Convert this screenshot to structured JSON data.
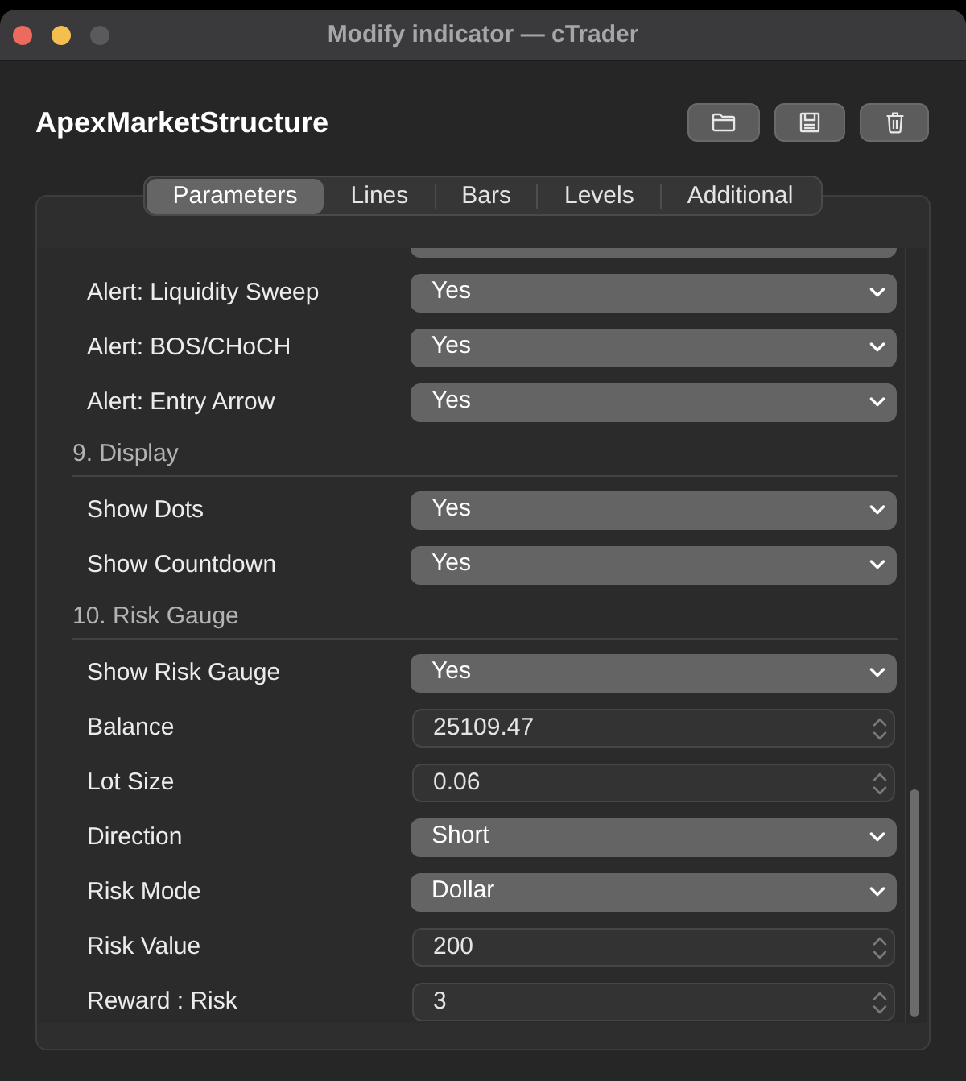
{
  "window": {
    "title": "Modify indicator — cTrader",
    "controls": [
      {
        "kind": "close",
        "disabled": false
      },
      {
        "kind": "minimize",
        "disabled": false
      },
      {
        "kind": "zoom",
        "disabled": true
      }
    ]
  },
  "indicator": {
    "name": "ApexMarketStructure"
  },
  "tabs": [
    {
      "label": "Parameters",
      "selected": true
    },
    {
      "label": "Lines",
      "selected": false
    },
    {
      "label": "Bars",
      "selected": false
    },
    {
      "label": "Levels",
      "selected": false
    },
    {
      "label": "Additional",
      "selected": false
    }
  ],
  "parameters": [
    {
      "kind": "select",
      "label": "Alert: Liquidity Sweep",
      "value": "Yes"
    },
    {
      "kind": "select",
      "label": "Alert: BOS/CHoCH",
      "value": "Yes"
    },
    {
      "kind": "select",
      "label": "Alert: Entry Arrow",
      "value": "Yes"
    },
    {
      "kind": "section",
      "title": "9. Display"
    },
    {
      "kind": "select",
      "label": "Show Dots",
      "value": "Yes"
    },
    {
      "kind": "select",
      "label": "Show Countdown",
      "value": "Yes"
    },
    {
      "kind": "section",
      "title": "10. Risk Gauge"
    },
    {
      "kind": "select",
      "label": "Show Risk Gauge",
      "value": "Yes"
    },
    {
      "kind": "number",
      "label": "Balance",
      "value": "25109.47"
    },
    {
      "kind": "number",
      "label": "Lot Size",
      "value": "0.06"
    },
    {
      "kind": "select",
      "label": "Direction",
      "value": "Short"
    },
    {
      "kind": "select",
      "label": "Risk Mode",
      "value": "Dollar"
    },
    {
      "kind": "number",
      "label": "Risk Value",
      "value": "200"
    },
    {
      "kind": "number",
      "label": "Reward : Risk",
      "value": "3"
    }
  ]
}
